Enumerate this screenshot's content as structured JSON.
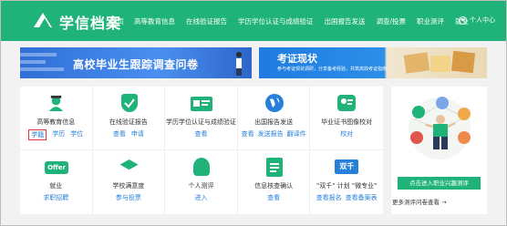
{
  "header": {
    "site_name": "学信档案",
    "nav": [
      "首页",
      "高等教育信息",
      "在线验证报告",
      "学历学位认证与成绩验证",
      "出国报告发送",
      "调查/投票",
      "职业测评",
      "就业"
    ],
    "user_label": "个人中心"
  },
  "banners": {
    "left_title": "高校毕业生跟踪调查问卷",
    "right_title": "考证现状",
    "right_subtitle": "参与考证现状调研，分享备考经验，共筑高效考证指南"
  },
  "services": [
    {
      "title": "高等教育信息",
      "links": [
        "学籍",
        "学历",
        "学位"
      ]
    },
    {
      "title": "在线验证报告",
      "links": [
        "查看",
        "申请"
      ]
    },
    {
      "title": "学历学位认证与成绩验证",
      "links": [
        "查看"
      ]
    },
    {
      "title": "出国报告发送",
      "links": [
        "查看",
        "发送报告",
        "翻译件"
      ]
    },
    {
      "title": "毕业证书图像校对",
      "links": [
        "校对"
      ]
    },
    {
      "title": "就业",
      "links": [
        "求职招聘"
      ]
    },
    {
      "title": "学校满意度",
      "links": [
        "参与投票"
      ]
    },
    {
      "title": "个人测评",
      "links": [
        "进入"
      ]
    },
    {
      "title": "信息核查确认",
      "links": [
        "查看"
      ]
    },
    {
      "title": "\"双千\" 计划 \"微专业\"",
      "links": [
        "查看报名",
        "查看备案表"
      ]
    }
  ],
  "service_icons": {
    "offer_text": "Offer",
    "dual_text": "双千"
  },
  "side": {
    "career_button": "点击进入职业兴趣测评",
    "more_link": "更多测评问卷查看 →"
  },
  "colors": {
    "brand_green": "#1fb37a",
    "link_blue": "#2680d9",
    "highlight_red": "#e53935"
  }
}
